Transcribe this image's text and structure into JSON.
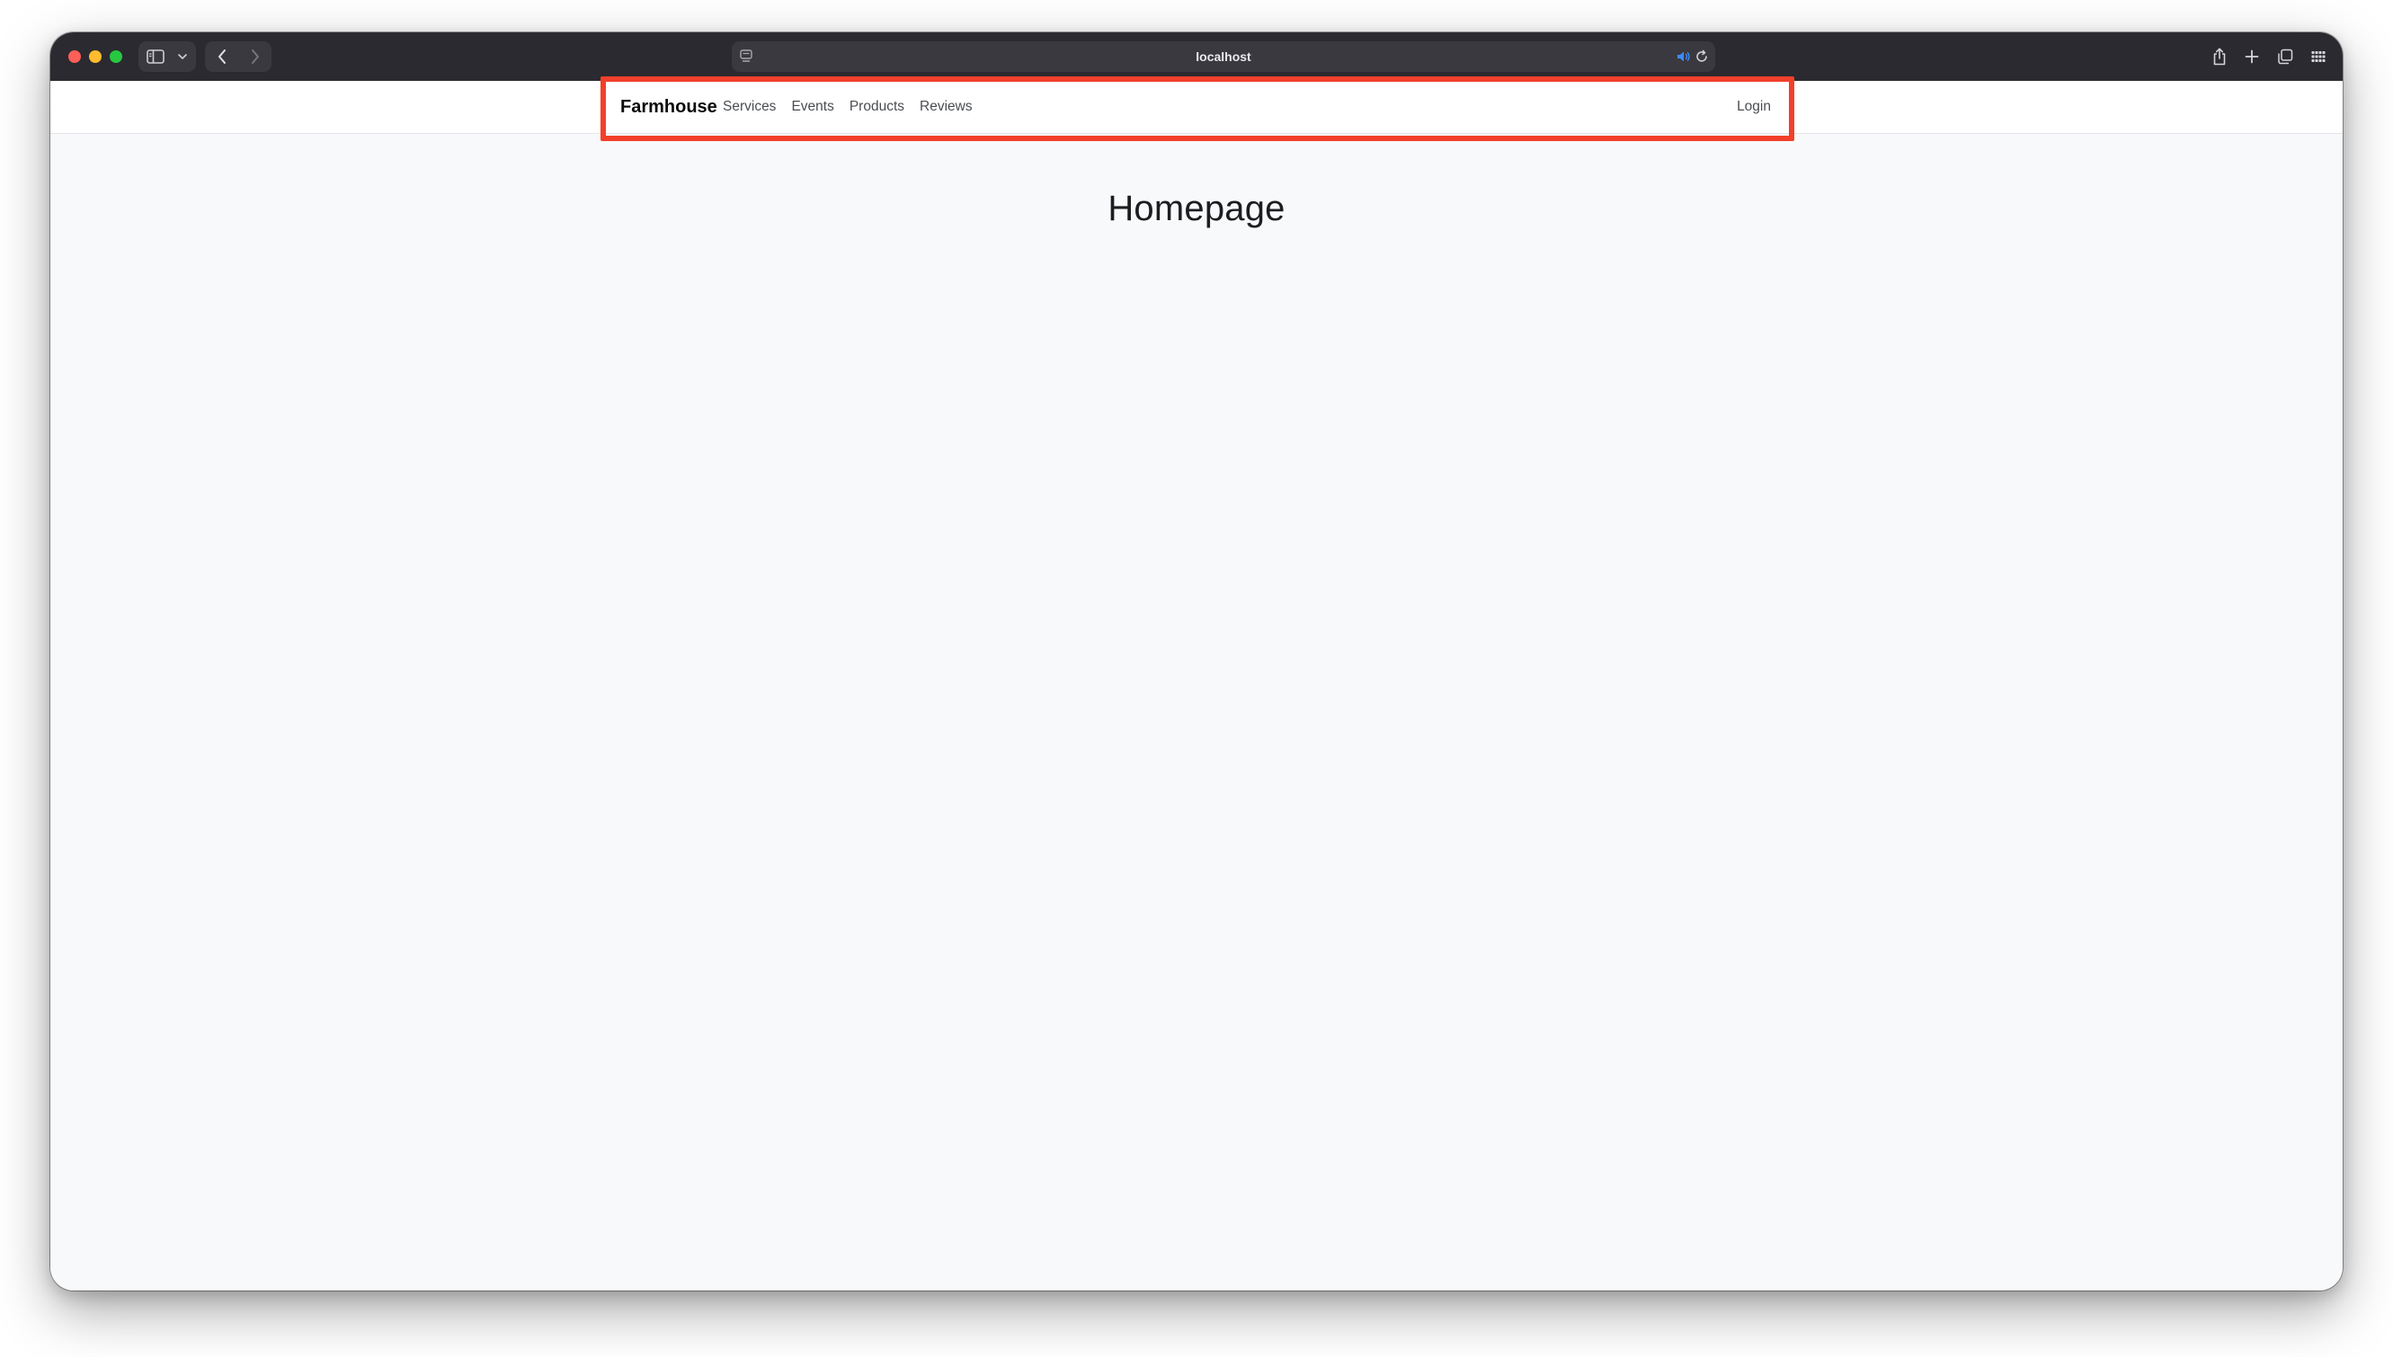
{
  "browser": {
    "url": "localhost",
    "icons": {
      "sidebar": "sidebar-icon",
      "sidebar_menu": "chevron-down-icon",
      "back": "chevron-left-icon",
      "forward": "chevron-right-icon",
      "site": "page-icon",
      "sound": "speaker-icon",
      "reload": "reload-icon",
      "share": "share-icon",
      "new_tab": "plus-icon",
      "tabs": "tab-overview-icon",
      "grid": "grid-icon"
    }
  },
  "navbar": {
    "brand": "Farmhouse",
    "links": [
      "Services",
      "Events",
      "Products",
      "Reviews"
    ],
    "login": "Login"
  },
  "main": {
    "title": "Homepage"
  },
  "colors": {
    "titlebar": "#2b2a30",
    "page_background": "#f8f9fb",
    "highlight": "#f2402a",
    "link_text": "#4a4d53"
  }
}
